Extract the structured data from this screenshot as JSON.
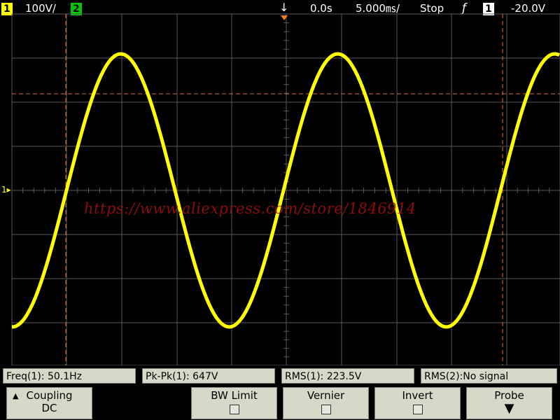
{
  "status": {
    "ch1_label": "1",
    "ch1_scale": "100V/",
    "ch2_label": "2",
    "time_delay": "0.0s",
    "time_scale": "5.000㎳/",
    "run_state": "Stop",
    "trigger_slope_glyph": "ƒ",
    "trigger_channel": "1",
    "trigger_level": "-20.0V",
    "trigger_pos_glyph": "↓"
  },
  "watermark": "https://www.aliexpress.com/store/1846914",
  "measurements": {
    "freq": "Freq(1): 50.1Hz",
    "pkpk": "Pk-Pk(1): 647V",
    "rms1": "RMS(1): 223.5V",
    "rms2": "RMS(2):No signal"
  },
  "softkeys": {
    "coupling_label": "Coupling",
    "coupling_value": "DC",
    "bw_limit_label": "BW Limit",
    "vernier_label": "Vernier",
    "invert_label": "Invert",
    "probe_label": "Probe"
  },
  "colors": {
    "trace": "#ffff00",
    "grid": "#5a5a5a",
    "cursor": "#e0703a"
  }
}
